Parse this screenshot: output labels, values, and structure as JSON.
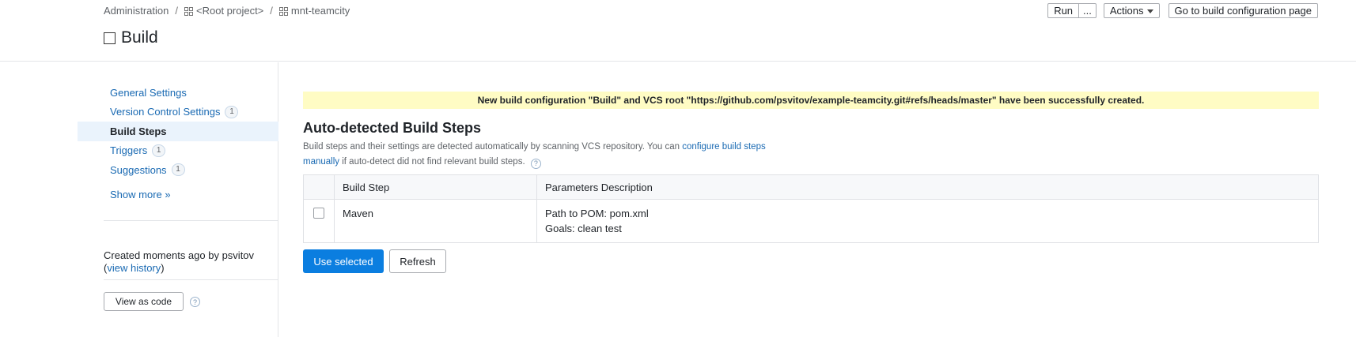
{
  "breadcrumb": {
    "items": [
      "Administration",
      "<Root project>",
      "mnt-teamcity"
    ],
    "separator": "/"
  },
  "header": {
    "title": "Build",
    "run_label": "Run",
    "more_label": "...",
    "actions_label": "Actions",
    "goto_label": "Go to build configuration page"
  },
  "sidebar": {
    "items": [
      {
        "label": "General Settings",
        "badge": ""
      },
      {
        "label": "Version Control Settings",
        "badge": "1"
      },
      {
        "label": "Build Steps",
        "badge": "",
        "active": true
      },
      {
        "label": "Triggers",
        "badge": "1"
      },
      {
        "label": "Suggestions",
        "badge": "1"
      }
    ],
    "show_more": "Show more »",
    "created_prefix": "Created moments ago by psvitov",
    "created_paren_open": "(",
    "view_history": "view history",
    "created_paren_close": ")",
    "view_as_code": "View as code",
    "help_glyph": "?"
  },
  "banner": {
    "text": "New build configuration \"Build\" and VCS root \"https://github.com/psvitov/example-teamcity.git#refs/heads/master\" have been successfully created."
  },
  "main": {
    "section_title": "Auto-detected Build Steps",
    "desc_text1": "Build steps and their settings are detected automatically by scanning VCS repository. You can ",
    "desc_link1": "configure build steps",
    "desc_link2": "manually",
    "desc_text2": " if auto-detect did not find relevant build steps.",
    "help_glyph": "?",
    "table": {
      "headers": [
        "",
        "Build Step",
        "Parameters Description"
      ],
      "rows": [
        {
          "step": "Maven",
          "params": [
            "Path to POM: pom.xml",
            "Goals: clean test"
          ]
        }
      ]
    },
    "use_selected_label": "Use selected",
    "refresh_label": "Refresh"
  },
  "colors": {
    "link": "#1a6ab3",
    "primary": "#0b7ee0",
    "banner_bg": "#fffcc4",
    "active_nav_bg": "#eaf3fc"
  },
  "icons": [
    "grid-icon",
    "checkbox-icon",
    "caret-down-icon",
    "help-icon"
  ]
}
